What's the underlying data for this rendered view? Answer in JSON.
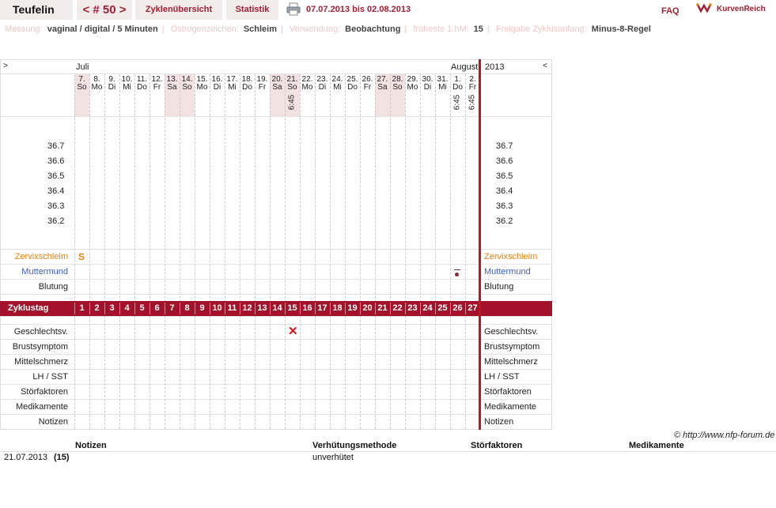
{
  "header": {
    "user": "Teufelin",
    "cycle_nav": "< # 50 >",
    "tabs": [
      "Zyklenübersicht",
      "Statistik"
    ],
    "date_range": "07.07.2013 bis 02.08.2013",
    "faq": "FAQ",
    "logo": "KurvenReich"
  },
  "settings": [
    {
      "label": "Messung:",
      "value": "vaginal / digital / 5 Minuten"
    },
    {
      "label": "Östrogenzeichen:",
      "value": "Schleim"
    },
    {
      "label": "Verwendung:",
      "value": "Beobachtung"
    },
    {
      "label": "früheste 1.hM:",
      "value": "15"
    },
    {
      "label": "Freigabe Zyklusanfang:",
      "value": "Minus-8-Regel"
    }
  ],
  "chart": {
    "nav_left": ">",
    "nav_right": "<",
    "month_start": "Juli",
    "month_end": "August",
    "year": "2013",
    "days": [
      {
        "d": "7.",
        "w": "So",
        "weekend": true,
        "time": ""
      },
      {
        "d": "8.",
        "w": "Mo",
        "weekend": false,
        "time": ""
      },
      {
        "d": "9.",
        "w": "Di",
        "weekend": false,
        "time": ""
      },
      {
        "d": "10.",
        "w": "Mi",
        "weekend": false,
        "time": ""
      },
      {
        "d": "11.",
        "w": "Do",
        "weekend": false,
        "time": ""
      },
      {
        "d": "12.",
        "w": "Fr",
        "weekend": false,
        "time": ""
      },
      {
        "d": "13.",
        "w": "Sa",
        "weekend": true,
        "time": ""
      },
      {
        "d": "14.",
        "w": "So",
        "weekend": true,
        "time": ""
      },
      {
        "d": "15.",
        "w": "Mo",
        "weekend": false,
        "time": ""
      },
      {
        "d": "16.",
        "w": "Di",
        "weekend": false,
        "time": ""
      },
      {
        "d": "17.",
        "w": "Mi",
        "weekend": false,
        "time": ""
      },
      {
        "d": "18.",
        "w": "Do",
        "weekend": false,
        "time": ""
      },
      {
        "d": "19.",
        "w": "Fr",
        "weekend": false,
        "time": ""
      },
      {
        "d": "20.",
        "w": "Sa",
        "weekend": true,
        "time": ""
      },
      {
        "d": "21.",
        "w": "So",
        "weekend": true,
        "time": "6:45"
      },
      {
        "d": "22.",
        "w": "Mo",
        "weekend": false,
        "time": ""
      },
      {
        "d": "23.",
        "w": "Di",
        "weekend": false,
        "time": ""
      },
      {
        "d": "24.",
        "w": "Mi",
        "weekend": false,
        "time": ""
      },
      {
        "d": "25.",
        "w": "Do",
        "weekend": false,
        "time": ""
      },
      {
        "d": "26.",
        "w": "Fr",
        "weekend": false,
        "time": ""
      },
      {
        "d": "27.",
        "w": "Sa",
        "weekend": true,
        "time": ""
      },
      {
        "d": "28.",
        "w": "So",
        "weekend": true,
        "time": ""
      },
      {
        "d": "29.",
        "w": "Mo",
        "weekend": false,
        "time": ""
      },
      {
        "d": "30.",
        "w": "Di",
        "weekend": false,
        "time": ""
      },
      {
        "d": "31.",
        "w": "Mi",
        "weekend": false,
        "time": ""
      },
      {
        "d": "1.",
        "w": "Do",
        "weekend": false,
        "time": "6:45"
      },
      {
        "d": "2.",
        "w": "Fr",
        "weekend": false,
        "time": "6:45"
      }
    ],
    "temp_ticks": [
      "36.7",
      "36.6",
      "36.5",
      "36.4",
      "36.3",
      "36.2"
    ],
    "rows_upper": [
      "Zervixschleim",
      "Muttermund",
      "Blutung"
    ],
    "row_upper_colors": [
      "#e8820c",
      "#3a5fcd",
      "#222222"
    ],
    "cycle_label": "Zyklustag",
    "cycle_days": [
      "1",
      "2",
      "3",
      "4",
      "5",
      "6",
      "7",
      "8",
      "9",
      "10",
      "11",
      "12",
      "13",
      "14",
      "15",
      "16",
      "17",
      "18",
      "19",
      "20",
      "21",
      "22",
      "23",
      "24",
      "25",
      "26",
      "27"
    ],
    "rows_lower": [
      "Geschlechtsv.",
      "Brustsymptom",
      "Mittelschmerz",
      "LH / SST",
      "Störfaktoren",
      "Medikamente",
      "Notizen"
    ],
    "marks": {
      "zervix_day1": "S",
      "geschlechtsverkehr_day": 15,
      "muttermund_day": 26
    },
    "colors": {
      "accent": "#a3122a",
      "weekend": "#f2e2e2",
      "divider": "#c0141e"
    }
  },
  "footer": {
    "copyright": "© http://www.nfp-forum.de",
    "headers": [
      "Notizen",
      "Verhütungsmethode",
      "Störfaktoren",
      "Medikamente"
    ],
    "row": {
      "date": "21.07.2013",
      "cycle_day": "(15)",
      "verhuetung": "unverhütet"
    }
  }
}
